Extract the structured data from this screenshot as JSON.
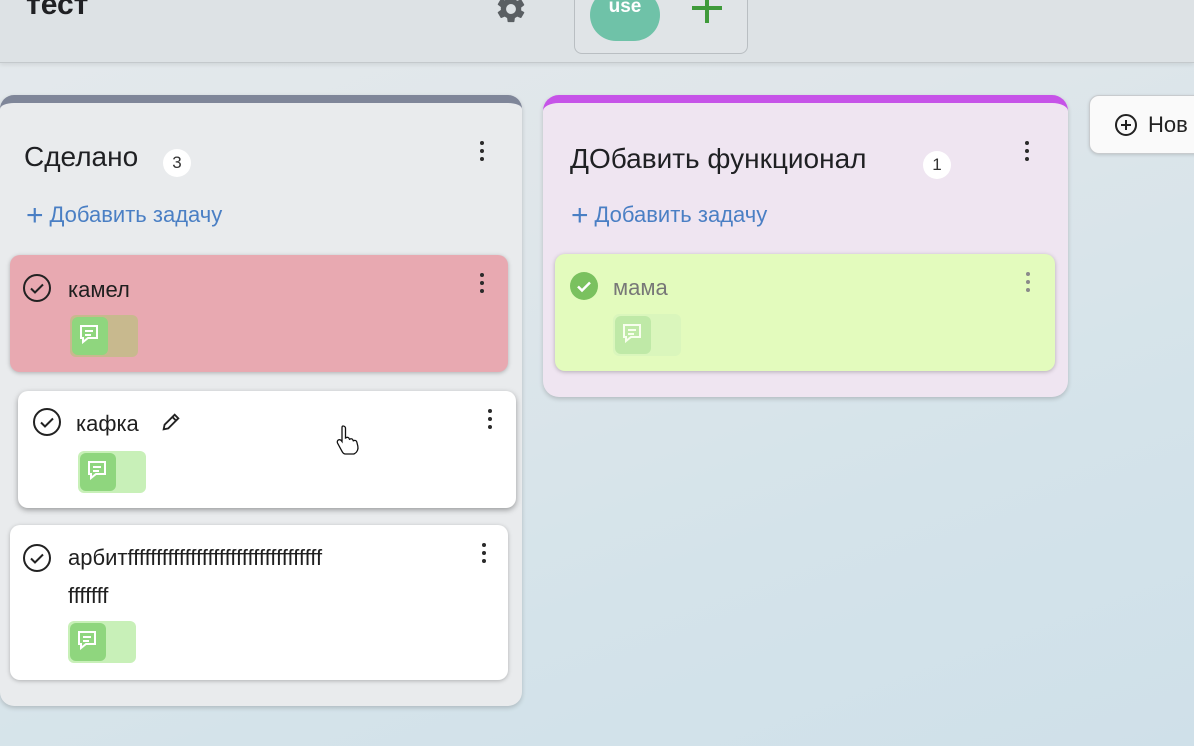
{
  "header": {
    "board_title": "тест",
    "avatar_initials": "use"
  },
  "columns": [
    {
      "title": "Сделано",
      "count": "3",
      "add_task_label": "Добавить задачу",
      "accent_color": "#7f8699",
      "cards": [
        {
          "text": "камел",
          "color": "#e8a9b1"
        },
        {
          "text": "кафка",
          "color": "#ffffff"
        },
        {
          "text_line1": "арбитffffffffffffffffffffffffffffffffff",
          "text_line2": "fffffff",
          "color": "#ffffff"
        }
      ]
    },
    {
      "title": "ДОбавить функционал",
      "count": "1",
      "add_task_label": "Добавить задачу",
      "accent_color": "#c653e8",
      "cards": [
        {
          "text": "мама",
          "color": "#e3fbbd",
          "done": true
        }
      ]
    }
  ],
  "new_column_button": {
    "label": "Нов"
  }
}
